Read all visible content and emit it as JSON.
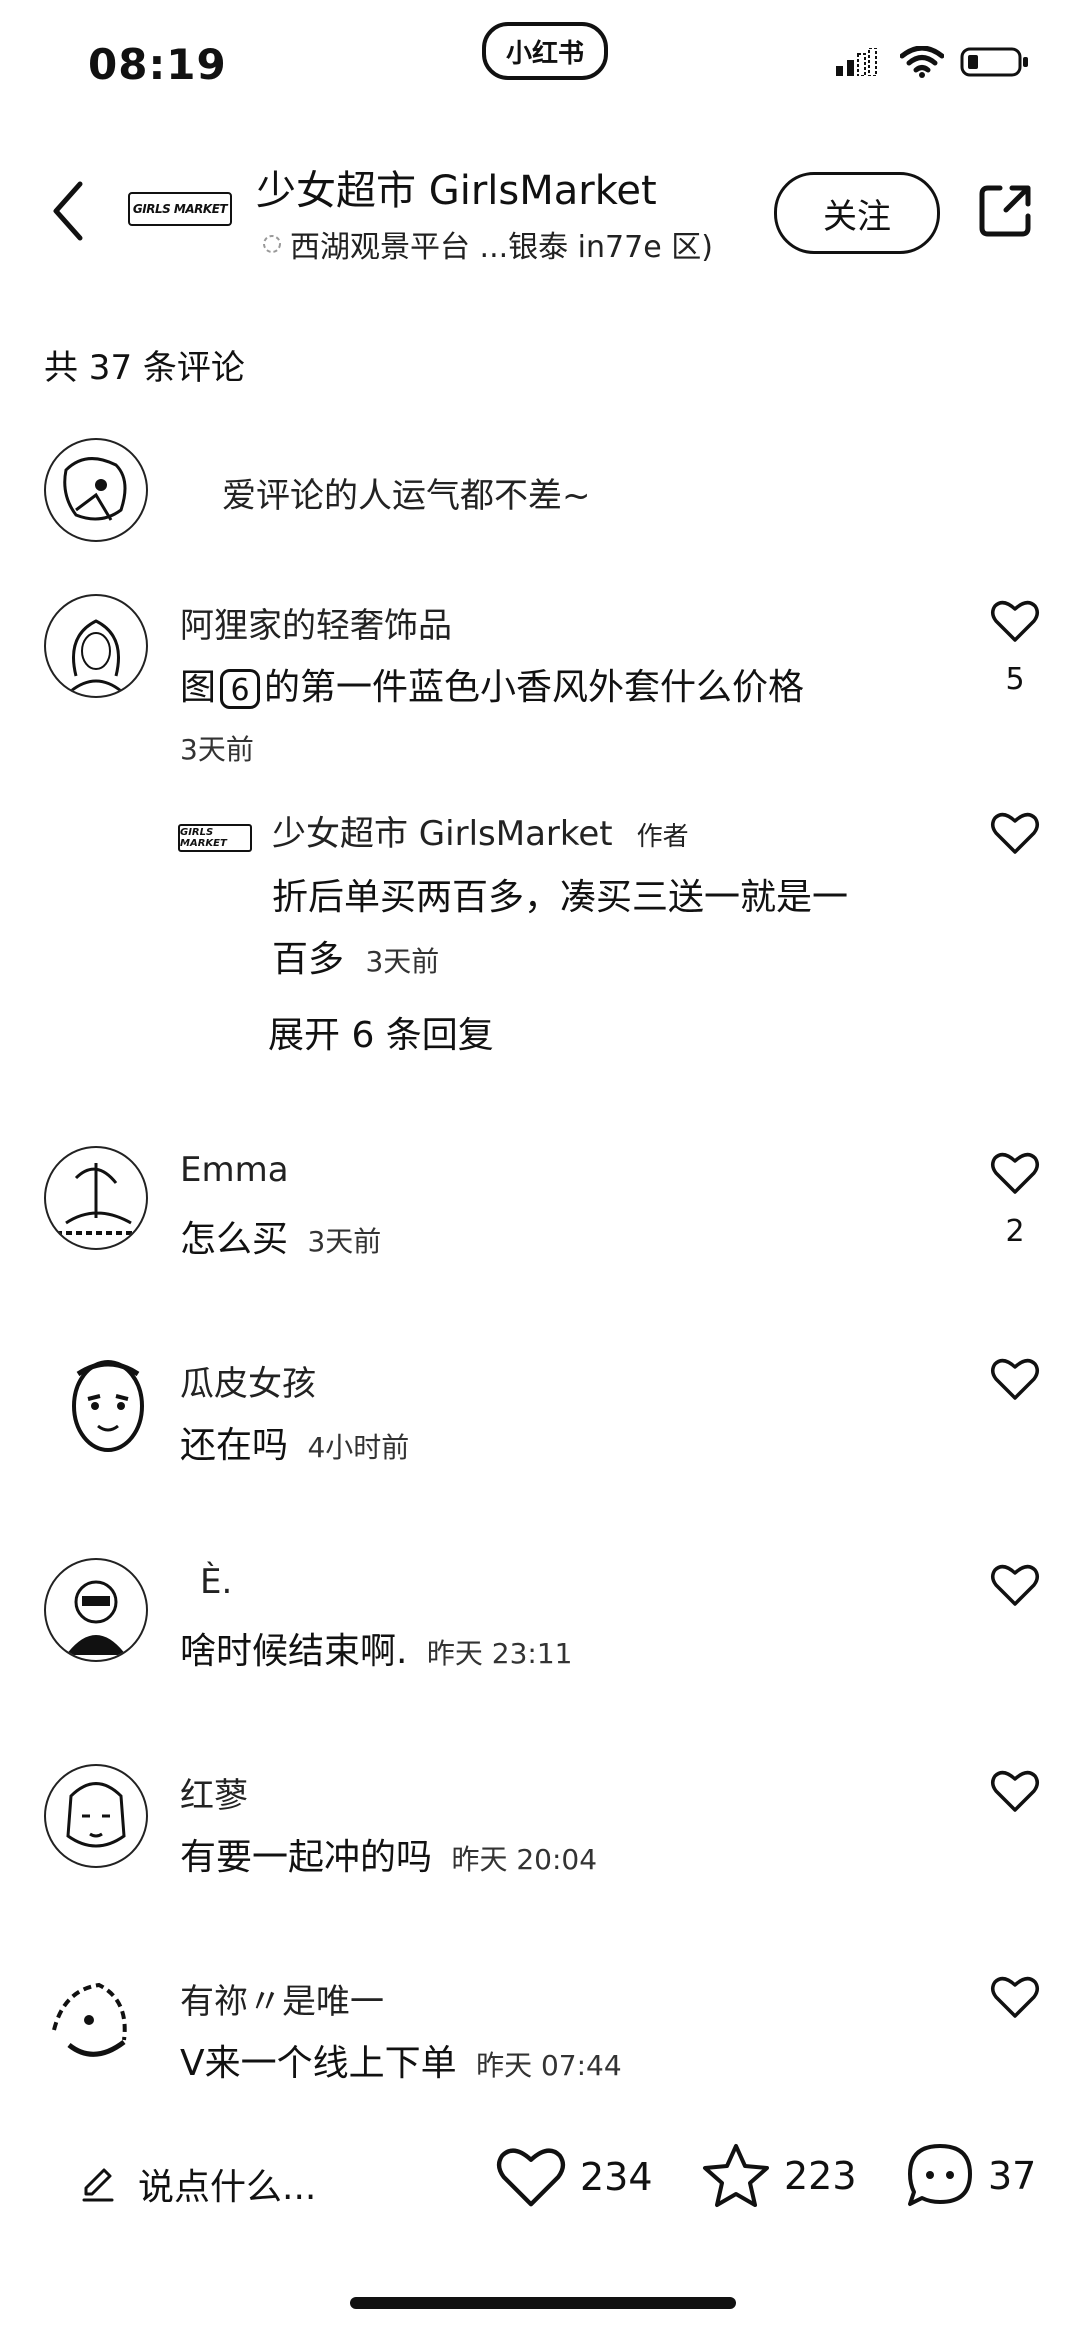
{
  "status_bar": {
    "time": "08:19",
    "app_name": "小红书"
  },
  "header": {
    "store_logo_text": "GIRLS MARKET",
    "title": "少女超市 GirlsMarket",
    "location": "西湖观景平台 ...银泰 in77e 区)",
    "follow_label": "关注"
  },
  "comments_header": {
    "count_text": "共 37 条评论",
    "invite_text": "爱评论的人运气都不差~"
  },
  "comments": [
    {
      "user": "阿狸家的轻奢饰品",
      "text_before": "图",
      "text_badge": "6",
      "text_after": "的第一件蓝色小香风外套什么价格",
      "time": "3天前",
      "likes": "5"
    },
    {
      "user": "Emma",
      "text": "怎么买",
      "time": "3天前",
      "likes": "2"
    },
    {
      "user": "瓜皮女孩",
      "text": "还在吗",
      "time": "4小时前",
      "likes": ""
    },
    {
      "user": "È.",
      "text": "啥时候结束啊.",
      "time": "昨天 23:11",
      "likes": ""
    },
    {
      "user": "红蓼",
      "text": "有要一起冲的吗",
      "time": "昨天 20:04",
      "likes": ""
    },
    {
      "user": "有祢〃是唯一",
      "text": "V来一个线上下单",
      "time": "昨天 07:44",
      "likes": ""
    }
  ],
  "reply": {
    "user": "少女超市 GirlsMarket",
    "author_tag": "作者",
    "text_line1": "折后单买两百多，凑买三送一就是一",
    "text_line2": "百多",
    "time": "3天前",
    "expand_label": "展开 6 条回复"
  },
  "bottom_bar": {
    "input_placeholder": "说点什么...",
    "likes": "234",
    "favorites": "223",
    "comments": "37"
  },
  "icons": {
    "back": "chevron-left-icon",
    "share": "share-icon",
    "like": "heart-icon",
    "favorite": "star-icon",
    "comment": "chat-bubble-icon",
    "edit": "pencil-icon"
  }
}
